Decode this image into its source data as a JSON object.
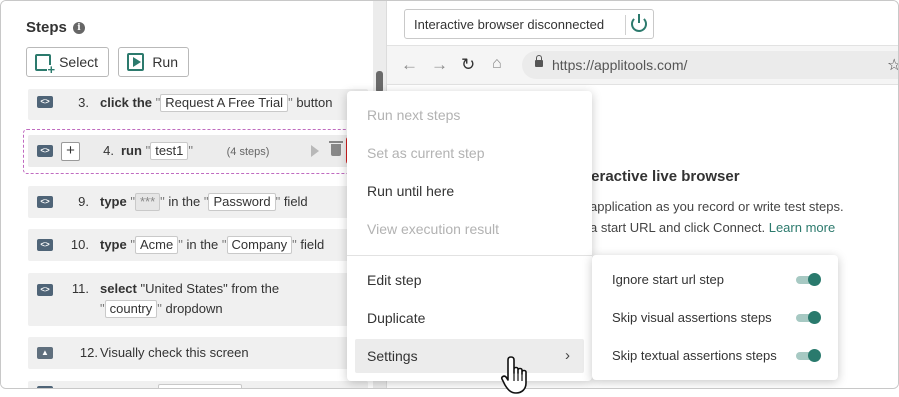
{
  "panel": {
    "title": "Steps",
    "select_label": "Select",
    "run_label": "Run"
  },
  "steps": [
    {
      "num": "3.",
      "verb": "click the",
      "q1": "\"",
      "value": "Request A Free Trial",
      "q2": "\"",
      "rest": "button"
    },
    {
      "num": "4.",
      "verb": "run",
      "q1": "\"",
      "value": "test1",
      "q2": "\"",
      "meta": "(4 steps)"
    },
    {
      "num": "9.",
      "verb": "type",
      "q1": "\"",
      "value": "***",
      "q2": "\"",
      "mid": "in the",
      "q3": "\"",
      "value2": "Password",
      "q4": "\"",
      "rest": "field"
    },
    {
      "num": "10.",
      "verb": "type",
      "q1": "\"",
      "value": "Acme",
      "q2": "\"",
      "mid": "in the",
      "q3": "\"",
      "value2": "Company",
      "q4": "\"",
      "rest": "field"
    },
    {
      "num": "11.",
      "verb": "select",
      "line1": "\"United States\" from the",
      "q1": "\"",
      "value": "country",
      "q2": "\"",
      "rest": "dropdown"
    },
    {
      "num": "12.",
      "line1": "Visually check this screen"
    }
  ],
  "browser": {
    "status": "Interactive browser disconnected",
    "url": "https://applitools.com/",
    "live_title": "nteractive live browser",
    "live_line1": "application as you record or write test steps.",
    "live_line2_a": "a start URL and click Connect.",
    "live_line2_b": "Learn more"
  },
  "menu": {
    "items": [
      {
        "label": "Run next steps",
        "disabled": true
      },
      {
        "label": "Set as current step",
        "disabled": true
      },
      {
        "label": "Run until here",
        "disabled": false
      },
      {
        "label": "View execution result",
        "disabled": true
      },
      {
        "label": "Edit step",
        "disabled": false
      },
      {
        "label": "Duplicate",
        "disabled": false
      },
      {
        "label": "Settings",
        "disabled": false
      }
    ]
  },
  "submenu": {
    "items": [
      {
        "label": "Ignore start url step",
        "on": true
      },
      {
        "label": "Skip visual assertions steps",
        "on": true
      },
      {
        "label": "Skip textual assertions steps",
        "on": true
      }
    ]
  },
  "colors": {
    "accent": "#2a7a6d",
    "highlight_border": "#d02020",
    "group_outline": "#c06bc0"
  }
}
